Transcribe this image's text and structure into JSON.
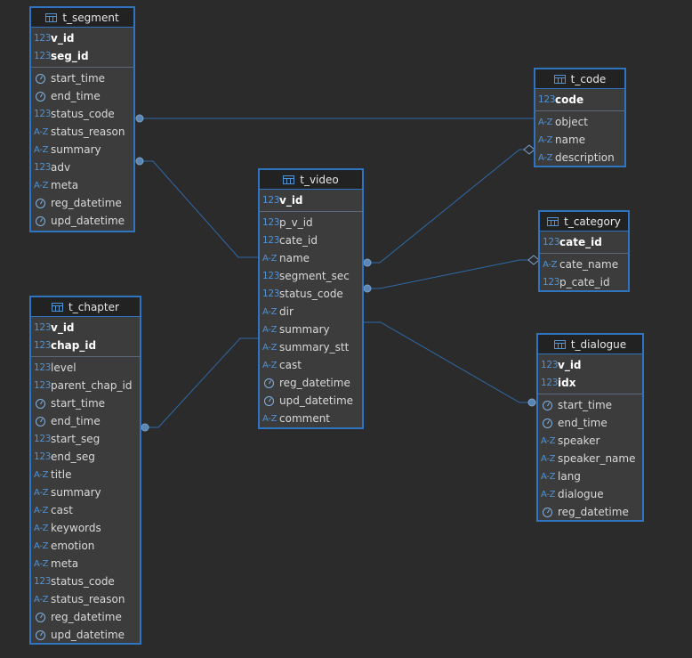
{
  "colors": {
    "background": "#2b2b2b",
    "border": "#2f74c0",
    "link": "#2f6aa8",
    "type_icon": "#4f93d6"
  },
  "icons": {
    "table": "table-grid-icon",
    "num": "123",
    "text": "A-Z",
    "time": "clock-icon"
  },
  "tables": [
    {
      "id": "t_segment",
      "title": "t_segment",
      "keys": [
        {
          "name": "v_id",
          "type": "num"
        },
        {
          "name": "seg_id",
          "type": "num"
        }
      ],
      "columns": [
        {
          "name": "start_time",
          "type": "time"
        },
        {
          "name": "end_time",
          "type": "time"
        },
        {
          "name": "status_code",
          "type": "num"
        },
        {
          "name": "status_reason",
          "type": "text"
        },
        {
          "name": "summary",
          "type": "text"
        },
        {
          "name": "adv",
          "type": "num"
        },
        {
          "name": "meta",
          "type": "text"
        },
        {
          "name": "reg_datetime",
          "type": "time"
        },
        {
          "name": "upd_datetime",
          "type": "time"
        }
      ]
    },
    {
      "id": "t_code",
      "title": "t_code",
      "keys": [
        {
          "name": "code",
          "type": "num"
        }
      ],
      "columns": [
        {
          "name": "object",
          "type": "text"
        },
        {
          "name": "name",
          "type": "text"
        },
        {
          "name": "description",
          "type": "text"
        }
      ]
    },
    {
      "id": "t_video",
      "title": "t_video",
      "keys": [
        {
          "name": "v_id",
          "type": "num"
        }
      ],
      "columns": [
        {
          "name": "p_v_id",
          "type": "num"
        },
        {
          "name": "cate_id",
          "type": "num"
        },
        {
          "name": "name",
          "type": "text"
        },
        {
          "name": "segment_sec",
          "type": "num"
        },
        {
          "name": "status_code",
          "type": "num"
        },
        {
          "name": "dir",
          "type": "text"
        },
        {
          "name": "summary",
          "type": "text"
        },
        {
          "name": "summary_stt",
          "type": "text"
        },
        {
          "name": "cast",
          "type": "text"
        },
        {
          "name": "reg_datetime",
          "type": "time"
        },
        {
          "name": "upd_datetime",
          "type": "time"
        },
        {
          "name": "comment",
          "type": "text"
        }
      ]
    },
    {
      "id": "t_category",
      "title": "t_category",
      "keys": [
        {
          "name": "cate_id",
          "type": "num"
        }
      ],
      "columns": [
        {
          "name": "cate_name",
          "type": "text"
        },
        {
          "name": "p_cate_id",
          "type": "num"
        }
      ]
    },
    {
      "id": "t_chapter",
      "title": "t_chapter",
      "keys": [
        {
          "name": "v_id",
          "type": "num"
        },
        {
          "name": "chap_id",
          "type": "num"
        }
      ],
      "columns": [
        {
          "name": "level",
          "type": "num"
        },
        {
          "name": "parent_chap_id",
          "type": "num"
        },
        {
          "name": "start_time",
          "type": "time"
        },
        {
          "name": "end_time",
          "type": "time"
        },
        {
          "name": "start_seg",
          "type": "num"
        },
        {
          "name": "end_seg",
          "type": "num"
        },
        {
          "name": "title",
          "type": "text"
        },
        {
          "name": "summary",
          "type": "text"
        },
        {
          "name": "cast",
          "type": "text"
        },
        {
          "name": "keywords",
          "type": "text"
        },
        {
          "name": "emotion",
          "type": "text"
        },
        {
          "name": "meta",
          "type": "text"
        },
        {
          "name": "status_code",
          "type": "num"
        },
        {
          "name": "status_reason",
          "type": "text"
        },
        {
          "name": "reg_datetime",
          "type": "time"
        },
        {
          "name": "upd_datetime",
          "type": "time"
        }
      ]
    },
    {
      "id": "t_dialogue",
      "title": "t_dialogue",
      "keys": [
        {
          "name": "v_id",
          "type": "num"
        },
        {
          "name": "idx",
          "type": "num"
        }
      ],
      "columns": [
        {
          "name": "start_time",
          "type": "time"
        },
        {
          "name": "end_time",
          "type": "time"
        },
        {
          "name": "speaker",
          "type": "text"
        },
        {
          "name": "speaker_name",
          "type": "text"
        },
        {
          "name": "lang",
          "type": "text"
        },
        {
          "name": "dialogue",
          "type": "text"
        },
        {
          "name": "reg_datetime",
          "type": "time"
        }
      ]
    }
  ],
  "relations": [
    {
      "from": "t_segment.status_code",
      "to": "t_code.code",
      "end": "dot"
    },
    {
      "from": "t_segment.adv",
      "to": "t_video.name",
      "end": "dot"
    },
    {
      "from": "t_video.name",
      "to": "t_code.object",
      "end": "diamond"
    },
    {
      "from": "t_video.status_code",
      "to": "t_category.cate_id",
      "end": "diamond"
    },
    {
      "from": "t_chapter.start_seg",
      "to": "t_video.summary",
      "end": "dot"
    },
    {
      "from": "t_video.summary_stt",
      "to": "t_dialogue.start_time",
      "end": "dot"
    }
  ]
}
